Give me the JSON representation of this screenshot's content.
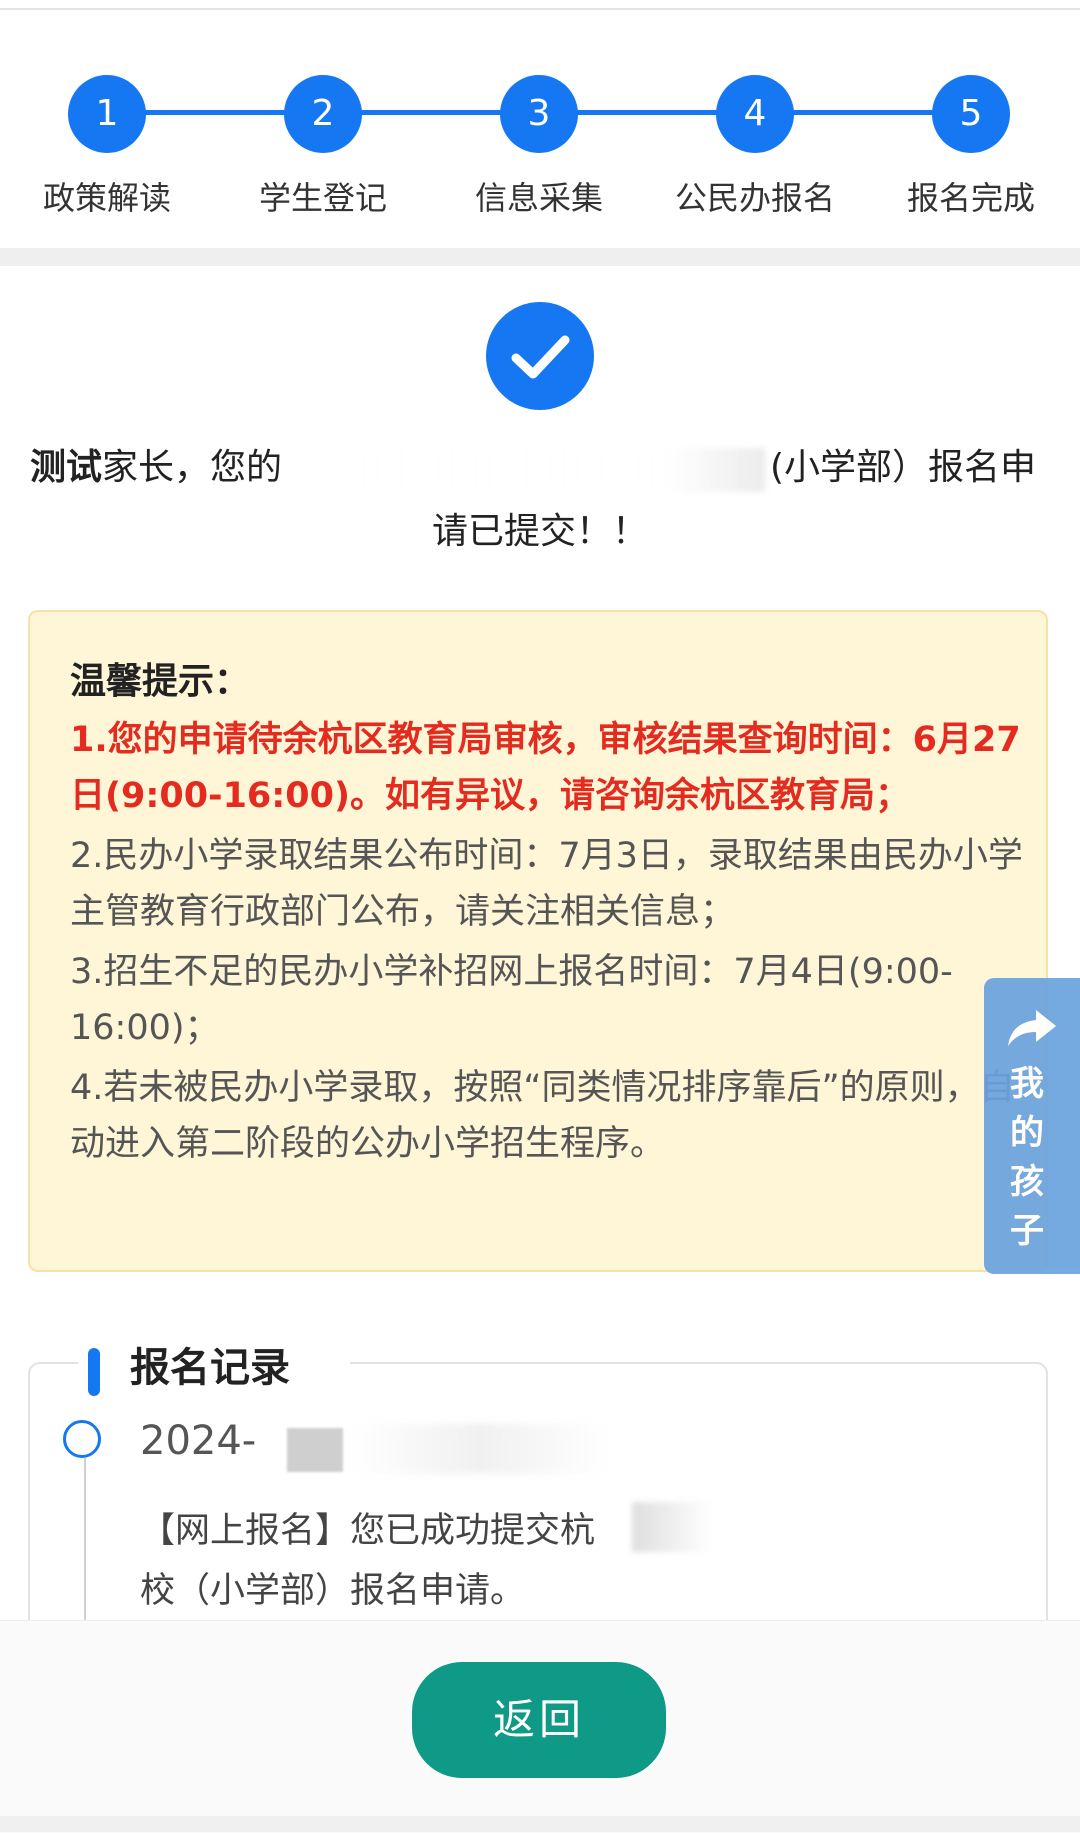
{
  "colors": {
    "primary_blue": "#1677f2",
    "tips_background": "#fff6d8",
    "tips_border": "#f7e1a8",
    "warning_red": "#e32b20",
    "side_tab_blue": "#6aa3de",
    "button_green": "#0e9a86"
  },
  "stepper": {
    "steps": [
      {
        "number": "1",
        "label": "政策解读"
      },
      {
        "number": "2",
        "label": "学生登记"
      },
      {
        "number": "3",
        "label": "信息采集"
      },
      {
        "number": "4",
        "label": "公民办报名"
      },
      {
        "number": "5",
        "label": "报名完成"
      }
    ]
  },
  "success": {
    "icon": "check-circle-icon",
    "parent_name": "测试",
    "line1_prefix": "家长，您的",
    "line1_suffix": "(小学部）报名申",
    "line2": "请已提交！！"
  },
  "tips": {
    "title": "温馨提示：",
    "items": [
      "1.您的申请待余杭区教育局审核，审核结果查询时间：6月27日(9:00-16:00)。如有异议，请咨询余杭区教育局；",
      "2.民办小学录取结果公布时间：7月3日，录取结果由民办小学主管教育行政部门公布，请关注相关信息；",
      "3.招生不足的民办小学补招网上报名时间：7月4日(9:00-16:00)；",
      "4.若未被民办小学录取，按照“同类情况排序靠后”的原则，自动进入第二阶段的公办小学招生程序。"
    ]
  },
  "side_tab": {
    "icon": "share-arrow-icon",
    "label": "我\n的\n孩\n子"
  },
  "records": {
    "title": "报名记录",
    "entry": {
      "date_prefix": "2024-",
      "line1": "【网上报名】您已成功提交杭",
      "line2": "校（小学部）报名申请。"
    }
  },
  "footer": {
    "back_label": "返回"
  }
}
